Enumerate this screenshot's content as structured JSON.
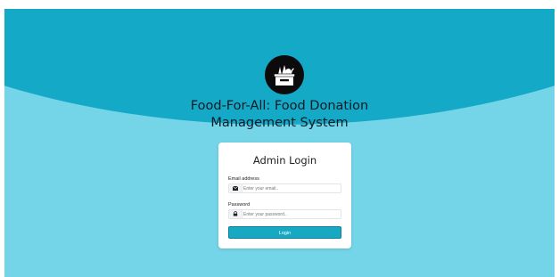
{
  "page": {
    "title_line1": "Food-For-All: Food Donation",
    "title_line2": "Management System"
  },
  "logo": {
    "icon": "food-donation-box-icon"
  },
  "login_card": {
    "heading": "Admin Login",
    "email": {
      "label": "Email address",
      "placeholder": "Enter your email..",
      "icon": "envelope-icon"
    },
    "password": {
      "label": "Password",
      "placeholder": "Enter your password..",
      "icon": "lock-icon"
    },
    "login_button_label": "Login"
  },
  "colors": {
    "header_wave": "#15a9c8",
    "background": "#74d5e8",
    "button": "#17a8c2",
    "card": "#ffffff"
  }
}
